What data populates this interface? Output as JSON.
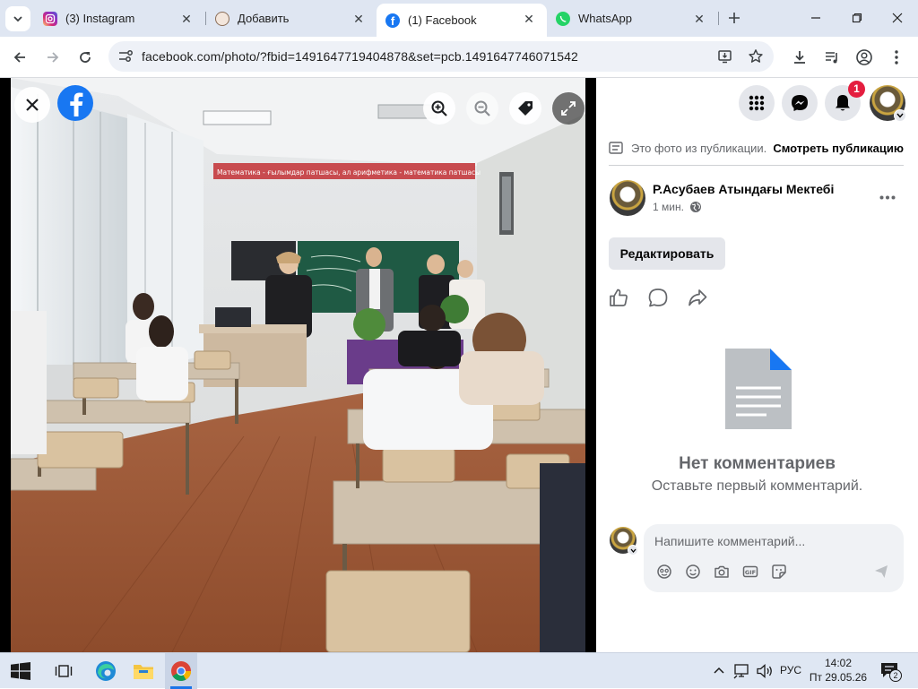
{
  "tabs": [
    {
      "label": "(3) Instagram",
      "icon": "instagram-icon",
      "color": "#e1306c"
    },
    {
      "label": "Добавить",
      "icon": "add-page-icon",
      "color": "#b07b56"
    },
    {
      "label": "(1) Facebook",
      "icon": "facebook-icon",
      "color": "#1877f2",
      "active": true
    },
    {
      "label": "WhatsApp",
      "icon": "whatsapp-icon",
      "color": "#25d366"
    }
  ],
  "toolbar": {
    "url": "facebook.com/photo/?fbid=1491647719404878&set=pcb.1491647746071542"
  },
  "header": {
    "notification_count": "1"
  },
  "post": {
    "source_text": "Это фото из публикации.",
    "view_post_link": "Смотреть публикацию",
    "author": "Р.Асубаев Атындағы Мектебі",
    "time": "1 мин.",
    "edit_button": "Редактировать",
    "no_comments_title": "Нет комментариев",
    "no_comments_subtitle": "Оставьте первый комментарий.",
    "comment_placeholder": "Напишите комментарий..."
  },
  "photo": {
    "banner_text": "Математика - ғылымдар патшасы, ал арифметика - математика патшасы"
  },
  "taskbar": {
    "language": "РУС",
    "time": "14:02",
    "date": "Пт 29.05.26",
    "notifications": "2"
  },
  "colors": {
    "tabstrip": "#dfe6f2",
    "facebook_blue": "#1877f2",
    "notification_red": "#e41e3f",
    "panel_button": "#e4e6eb"
  }
}
